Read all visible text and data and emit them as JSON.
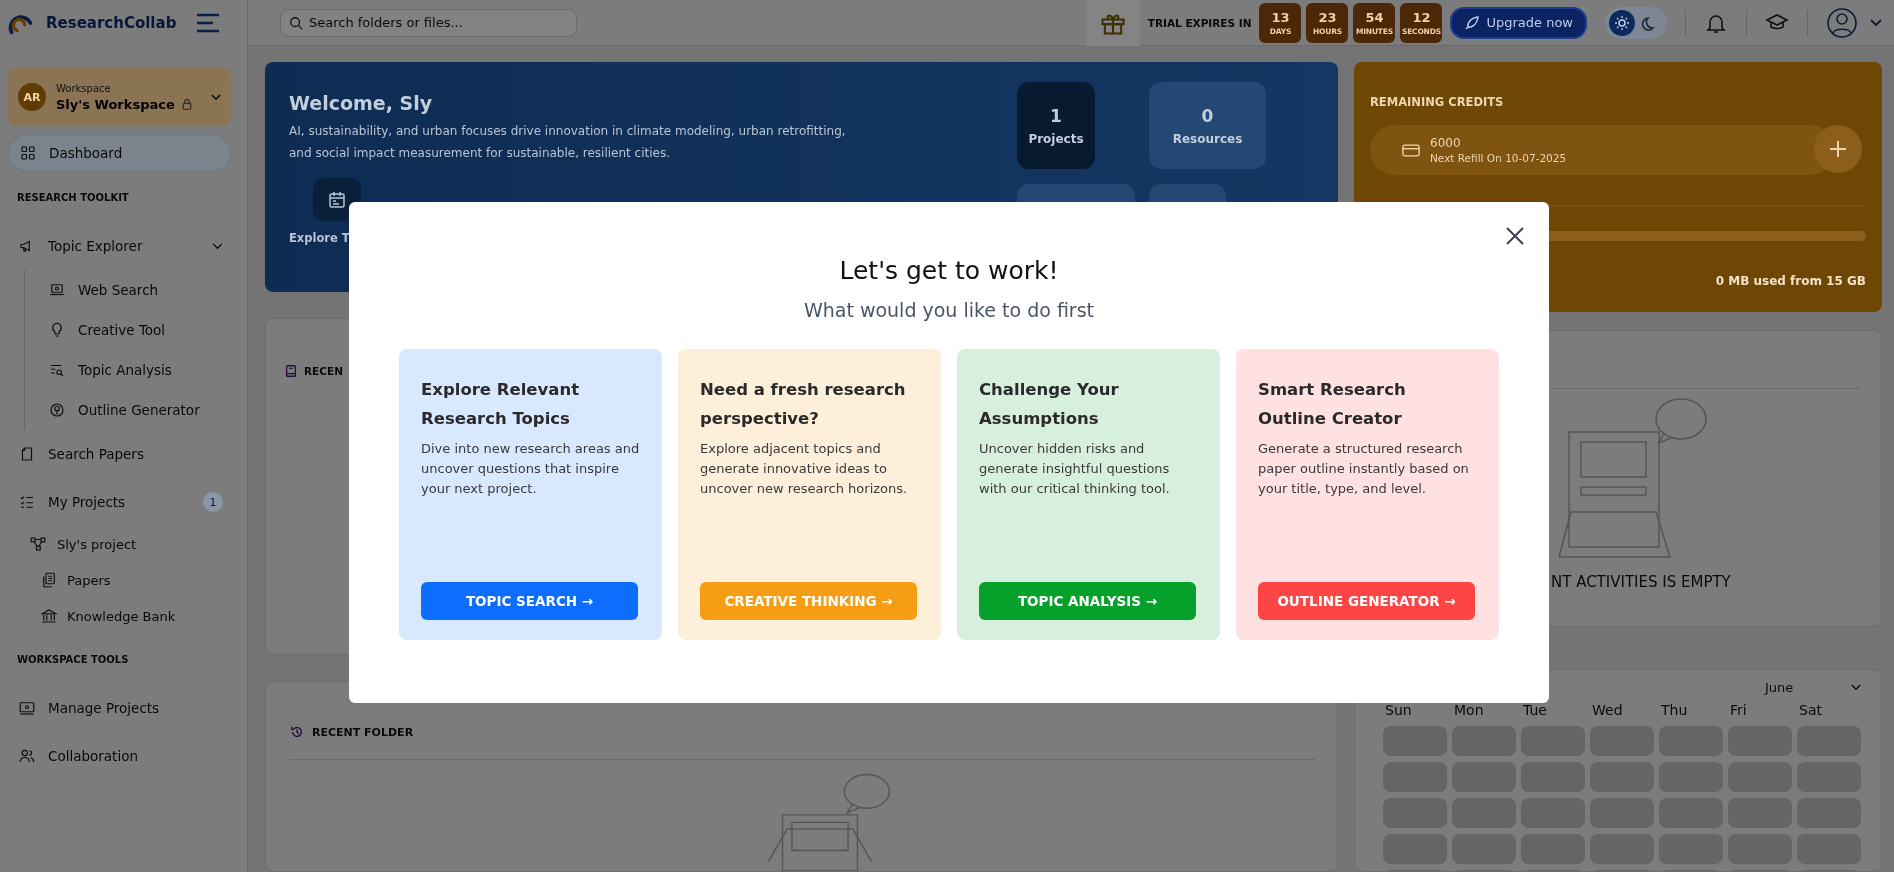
{
  "brand": {
    "name": "ResearchCollab"
  },
  "search": {
    "placeholder": "Search folders or files..."
  },
  "trial": {
    "label": "TRIAL EXPIRES IN",
    "countdown": [
      {
        "value": "13",
        "unit": "DAYS"
      },
      {
        "value": "23",
        "unit": "HOURS"
      },
      {
        "value": "54",
        "unit": "MINUTES"
      },
      {
        "value": "12",
        "unit": "SECONDS"
      }
    ]
  },
  "upgrade_button": "Upgrade now",
  "theme_toggle": {
    "dark_mode": false
  },
  "sidebar": {
    "workspace": {
      "initials": "AR",
      "label": "Workspace",
      "name": "Sly's Workspace"
    },
    "items": [
      {
        "kind": "nav",
        "label": "Dashboard",
        "selected": true
      },
      {
        "kind": "section",
        "label": "RESEARCH TOOLKIT"
      },
      {
        "kind": "nav",
        "label": "Topic Explorer",
        "selected": false,
        "expanded": true,
        "children": [
          {
            "kind": "tool",
            "label": "Web Search",
            "selected": false
          },
          {
            "kind": "tool",
            "label": "Creative Tool",
            "selected": false
          },
          {
            "kind": "tool",
            "label": "Topic Analysis",
            "selected": false
          },
          {
            "kind": "tool",
            "label": "Outline Generator",
            "selected": false
          }
        ]
      },
      {
        "kind": "nav",
        "label": "Search Papers",
        "selected": false
      },
      {
        "kind": "nav",
        "label": "My Projects",
        "selected": false,
        "badge": "1",
        "children": [
          {
            "kind": "project",
            "label": "Sly's project",
            "selected": false,
            "children": [
              {
                "kind": "folder",
                "label": "Papers",
                "selected": false
              },
              {
                "kind": "folder",
                "label": "Knowledge Bank",
                "selected": false
              }
            ]
          }
        ]
      },
      {
        "kind": "section",
        "label": "WORKSPACE TOOLS"
      },
      {
        "kind": "nav",
        "label": "Manage Projects",
        "selected": false
      },
      {
        "kind": "nav",
        "label": "Collaboration",
        "selected": false
      }
    ]
  },
  "welcome": {
    "title": "Welcome, Sly",
    "text": "AI, sustainability, and urban focuses drive innovation in climate modeling, urban retrofitting, and social impact measurement for sustainable, resilient cities.",
    "stats": [
      {
        "value": "1",
        "label": "Projects",
        "highlighted": true
      },
      {
        "value": "0",
        "label": "Resources",
        "highlighted": false
      }
    ],
    "quick_action": {
      "label": "Explore T"
    }
  },
  "credits": {
    "title": "REMAINING CREDITS",
    "amount": "6000",
    "refill": "Next Refill On 10-07-2025",
    "storage": {
      "text": "0 MB used from 15 GB",
      "level": 0
    }
  },
  "recent": {
    "title": "RECEN"
  },
  "recent_folder": {
    "title": "RECENT FOLDER"
  },
  "activities": {
    "empty_text": "NT ACTIVITIES IS EMPTY"
  },
  "calendar": {
    "month": "June",
    "weekdays": [
      "Sun",
      "Mon",
      "Tue",
      "Wed",
      "Thu",
      "Fri",
      "Sat"
    ]
  },
  "modal": {
    "title": "Let's get to work!",
    "subtitle": "What would you like to do first",
    "cards": [
      {
        "title": "Explore Relevant Research Topics",
        "text": "Dive into new research areas and uncover questions that inspire your next project.",
        "button": "TOPIC SEARCH →",
        "color": "#0d6efd"
      },
      {
        "title": "Need a fresh research perspective?",
        "text": "Explore adjacent topics and generate innovative ideas to uncover new research horizons.",
        "button": "CREATIVE THINKING →",
        "color": "#f59e14"
      },
      {
        "title": "Challenge Your Assumptions",
        "text": "Uncover hidden risks and generate insightful questions with our critical thinking tool.",
        "button": "TOPIC ANALYSIS →",
        "color": "#06a12a"
      },
      {
        "title": "Smart Research Outline Creator",
        "text": "Generate a structured research paper outline instantly based on your title, type, and level.",
        "button": "OUTLINE GENERATOR →",
        "color": "#fd4545"
      }
    ]
  }
}
